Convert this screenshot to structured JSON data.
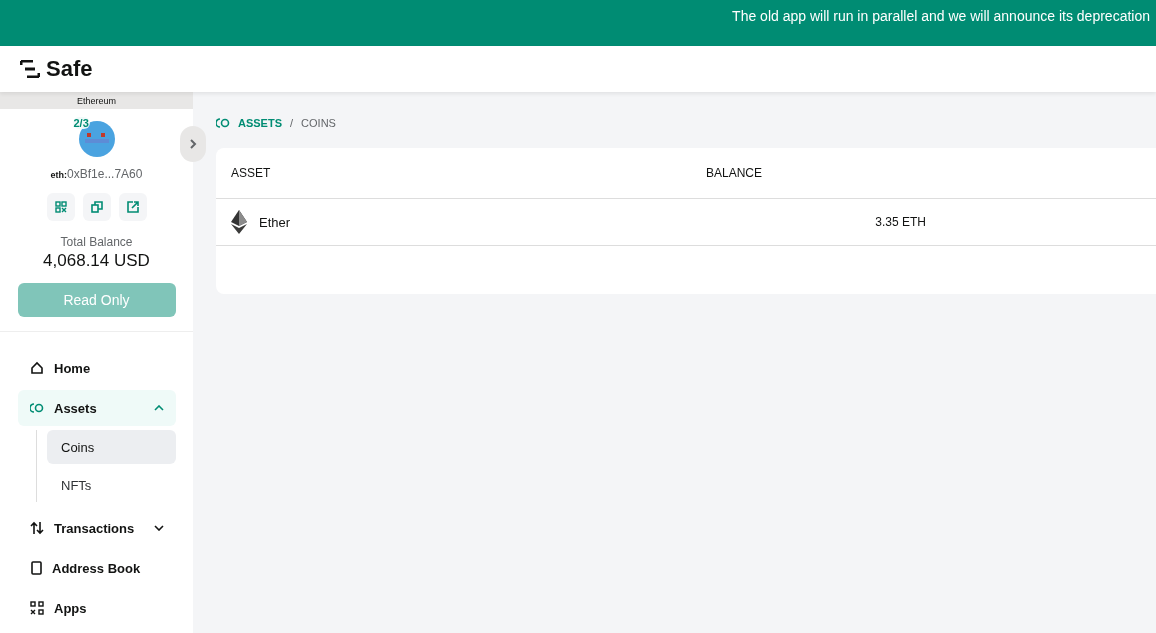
{
  "banner": {
    "text": "The old app will run in parallel and we will announce its deprecation"
  },
  "header": {
    "logo": "Safe"
  },
  "sidebar": {
    "network": "Ethereum",
    "threshold": "2/3",
    "address_prefix": "eth:",
    "address": "0xBf1e...7A60",
    "balance_label": "Total Balance",
    "balance": "4,068.14 USD",
    "read_only_button": "Read Only",
    "nav": [
      {
        "label": "Home",
        "selected": false
      },
      {
        "label": "Assets",
        "selected": true,
        "expanded": true,
        "children": [
          {
            "label": "Coins",
            "selected": true
          },
          {
            "label": "NFTs",
            "selected": false
          }
        ]
      },
      {
        "label": "Transactions",
        "selected": false,
        "expanded": false
      },
      {
        "label": "Address Book",
        "selected": false
      },
      {
        "label": "Apps",
        "selected": false
      }
    ]
  },
  "breadcrumb": {
    "section": "ASSETS",
    "separator": "/",
    "page": "COINS"
  },
  "table": {
    "columns": [
      "ASSET",
      "BALANCE"
    ],
    "rows": [
      {
        "asset": "Ether",
        "balance": "3.35 ETH"
      }
    ]
  }
}
